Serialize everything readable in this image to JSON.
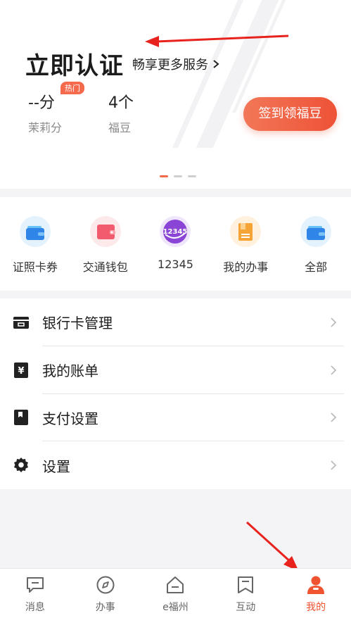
{
  "header": {
    "title": "立即认证",
    "more_link": "畅享更多服务",
    "hot_badge": "热门",
    "stats": [
      {
        "value": "--分",
        "label": "茉莉分"
      },
      {
        "value": "4个",
        "label": "福豆"
      }
    ],
    "signin_button": "签到领福豆",
    "pager": {
      "count": 3,
      "active_index": 0
    }
  },
  "shortcuts": [
    {
      "label": "证照卡券",
      "icon": "wallet-icon"
    },
    {
      "label": "交通钱包",
      "icon": "transport-wallet-icon"
    },
    {
      "label": "12345",
      "icon": "hotline-12345-icon"
    },
    {
      "label": "我的办事",
      "icon": "folder-icon"
    },
    {
      "label": "全部",
      "icon": "wallet-icon"
    }
  ],
  "menu": [
    {
      "label": "银行卡管理",
      "icon": "bank-card-icon"
    },
    {
      "label": "我的账单",
      "icon": "bill-icon"
    },
    {
      "label": "支付设置",
      "icon": "bookmark-icon"
    },
    {
      "label": "设置",
      "icon": "gear-icon"
    }
  ],
  "tabbar": {
    "items": [
      {
        "label": "消息",
        "icon": "message-icon"
      },
      {
        "label": "办事",
        "icon": "compass-icon"
      },
      {
        "label": "e福州",
        "icon": "home-icon"
      },
      {
        "label": "互动",
        "icon": "flag-icon"
      },
      {
        "label": "我的",
        "icon": "user-icon"
      }
    ],
    "active_index": 4
  },
  "colors": {
    "accent": "#f0532f",
    "background": "#f4f4f6",
    "annotation_arrow": "#e8231e"
  }
}
